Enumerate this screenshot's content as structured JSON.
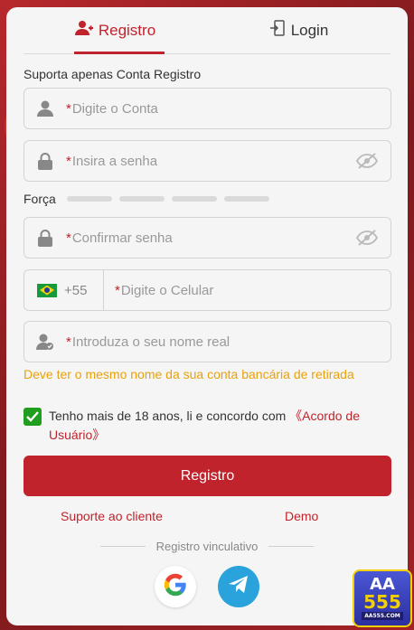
{
  "tabs": {
    "register": "Registro",
    "login": "Login"
  },
  "support_label": "Suporta apenas Conta Registro",
  "fields": {
    "account": {
      "required": "*",
      "placeholder": "Digite o Conta"
    },
    "password": {
      "required": "*",
      "placeholder": "Insira a senha"
    },
    "confirm": {
      "required": "*",
      "placeholder": "Confirmar senha"
    },
    "phone": {
      "prefix": "+55",
      "required": "*",
      "placeholder": "Digite o Celular"
    },
    "realname": {
      "required": "*",
      "placeholder": "Introduza o seu nome real"
    }
  },
  "strength_label": "Força",
  "warning": "Deve ter o mesmo nome da sua conta bancária de retirada",
  "agreement": {
    "text": "Tenho mais de 18 anos, li e concordo com ",
    "link": "《Acordo de Usuário》"
  },
  "submit_label": "Registro",
  "links": {
    "support": "Suporte ao cliente",
    "demo": "Demo"
  },
  "divider_text": "Registro vinculativo",
  "brand": {
    "line1": "AA",
    "line2": "555",
    "line3": "AA555.COM"
  },
  "colors": {
    "accent": "#c0232b",
    "warning": "#e8a10a",
    "check": "#1f9e1f"
  }
}
